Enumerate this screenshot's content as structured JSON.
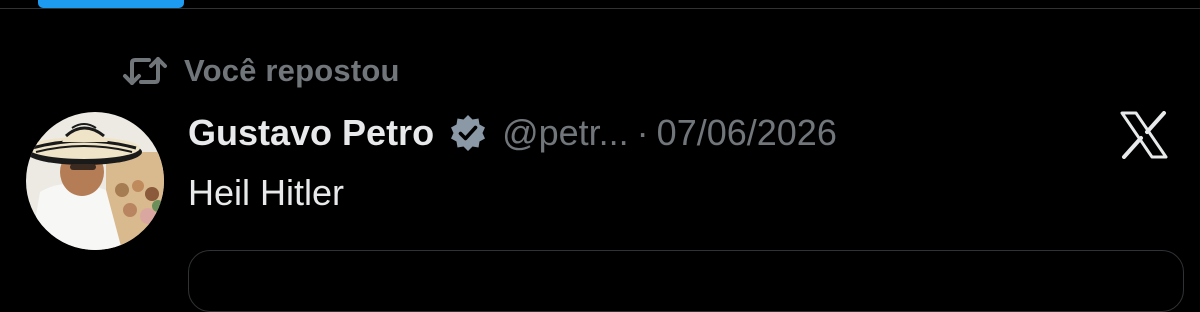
{
  "repost": {
    "label": "Você repostou",
    "icon": "repost-icon"
  },
  "tweet": {
    "author": {
      "display_name": "Gustavo Petro",
      "handle": "@petr...",
      "verified": true,
      "avatar_icon": "avatar"
    },
    "separator": "·",
    "date": "07/06/2026",
    "text": "Heil Hitler"
  },
  "colors": {
    "background": "#000000",
    "primary_text": "#e7e9ea",
    "secondary_text": "#71767b",
    "accent": "#1d9bf0",
    "divider": "#2f3336"
  }
}
